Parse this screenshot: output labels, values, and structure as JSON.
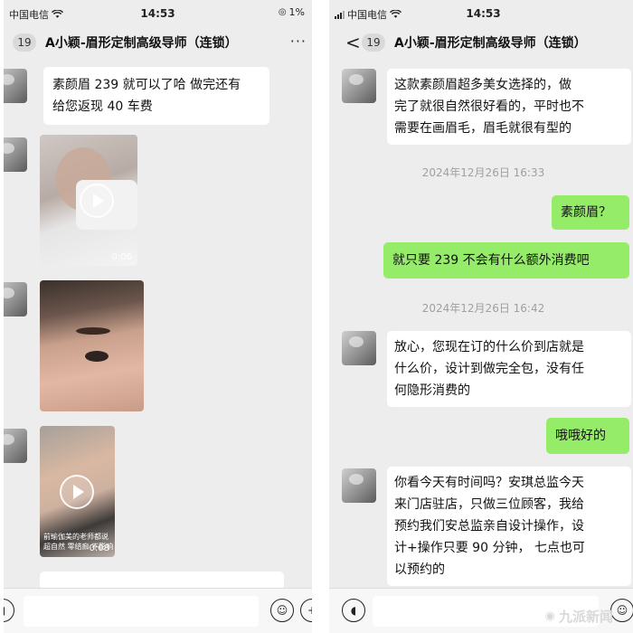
{
  "left_screen": {
    "status": {
      "carrier": "中国电信",
      "time": "14:53",
      "battery": "1%"
    },
    "nav": {
      "unread": "19",
      "title": "A小颖-眉形定制高级导师（连锁）",
      "more": "···"
    },
    "messages": [
      {
        "type": "text",
        "from": "other",
        "text": "素颜眉 239 就可以了哈 做完还有\n给您返现 40 车费"
      },
      {
        "type": "video",
        "from": "other",
        "duration": "0:06"
      },
      {
        "type": "image",
        "from": "other"
      },
      {
        "type": "video",
        "from": "other",
        "duration": "0:08",
        "caption": "前瑜伽美的老师都说\n超自然 零结痂 不影响"
      }
    ]
  },
  "right_screen": {
    "status": {
      "carrier": "中国电信",
      "time": "14:53"
    },
    "nav": {
      "back": "<",
      "unread": "19",
      "title": "A小颖-眉形定制高级导师（连锁）"
    },
    "messages": [
      {
        "type": "text",
        "from": "other",
        "text": "这款素颜眉超多美女选择的，做\n完了就很自然很好看的，平时也不\n需要在画眉毛，眉毛就很有型的"
      },
      {
        "type": "time",
        "text": "2024年12月26日 16:33"
      },
      {
        "type": "text",
        "from": "me",
        "text": "素颜眉？"
      },
      {
        "type": "text",
        "from": "me",
        "text": "就只要 239 不会有什么额外消费吧"
      },
      {
        "type": "time",
        "text": "2024年12月26日 16:42"
      },
      {
        "type": "text",
        "from": "other",
        "text": "放心，您现在订的什么价到店就是\n什么价，设计到做完全包，没有任\n何隐形消费的"
      },
      {
        "type": "text",
        "from": "me",
        "text": "哦哦好的"
      },
      {
        "type": "text",
        "from": "other",
        "text": "你看今天有时间吗？安琪总监今天\n来门店驻店，只做三位顾客，我给\n预约我们安总监亲自设计操作，设\n计+操作只要 90 分钟， 七点也可\n以预约的"
      }
    ]
  },
  "watermark": "九派新闻",
  "colors": {
    "chat_bg": "#ededed",
    "my_bubble": "#95ec69",
    "other_bubble": "#ffffff",
    "timestamp": "#a0a0a0"
  }
}
